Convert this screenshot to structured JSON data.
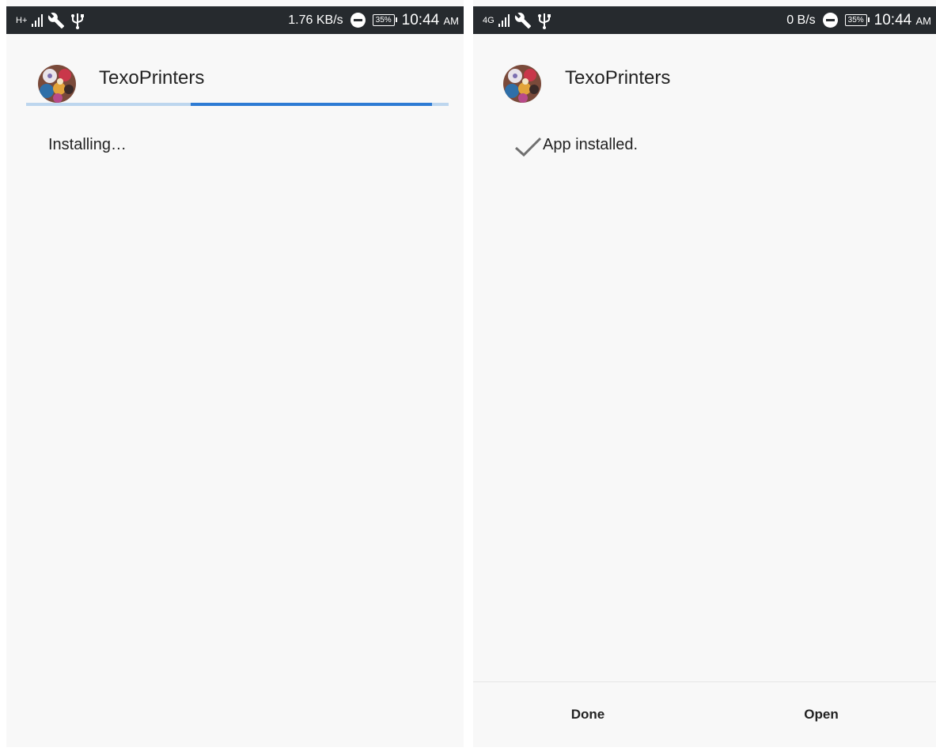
{
  "left_screen": {
    "status_bar": {
      "network_type": "H+",
      "data_speed": "1.76 KB/s",
      "battery": "35%",
      "time": "10:44",
      "time_suffix": "AM"
    },
    "app_name": "TexoPrinters",
    "status_text": "Installing…",
    "progress": {
      "visible_start": 0.39,
      "visible_end": 0.96
    }
  },
  "right_screen": {
    "status_bar": {
      "network_type": "4G",
      "data_speed": "0 B/s",
      "battery": "35%",
      "time": "10:44",
      "time_suffix": "AM"
    },
    "app_name": "TexoPrinters",
    "status_text": "App installed.",
    "buttons": {
      "done": "Done",
      "open": "Open"
    }
  },
  "colors": {
    "status_bar": "#262a2e",
    "progress_track": "#bdd6ee",
    "progress_fill": "#2d7bd4",
    "background": "#f8f8f8"
  },
  "icons": [
    "signal-icon",
    "wrench-icon",
    "usb-icon",
    "dnd-icon",
    "battery-icon",
    "check-icon"
  ]
}
